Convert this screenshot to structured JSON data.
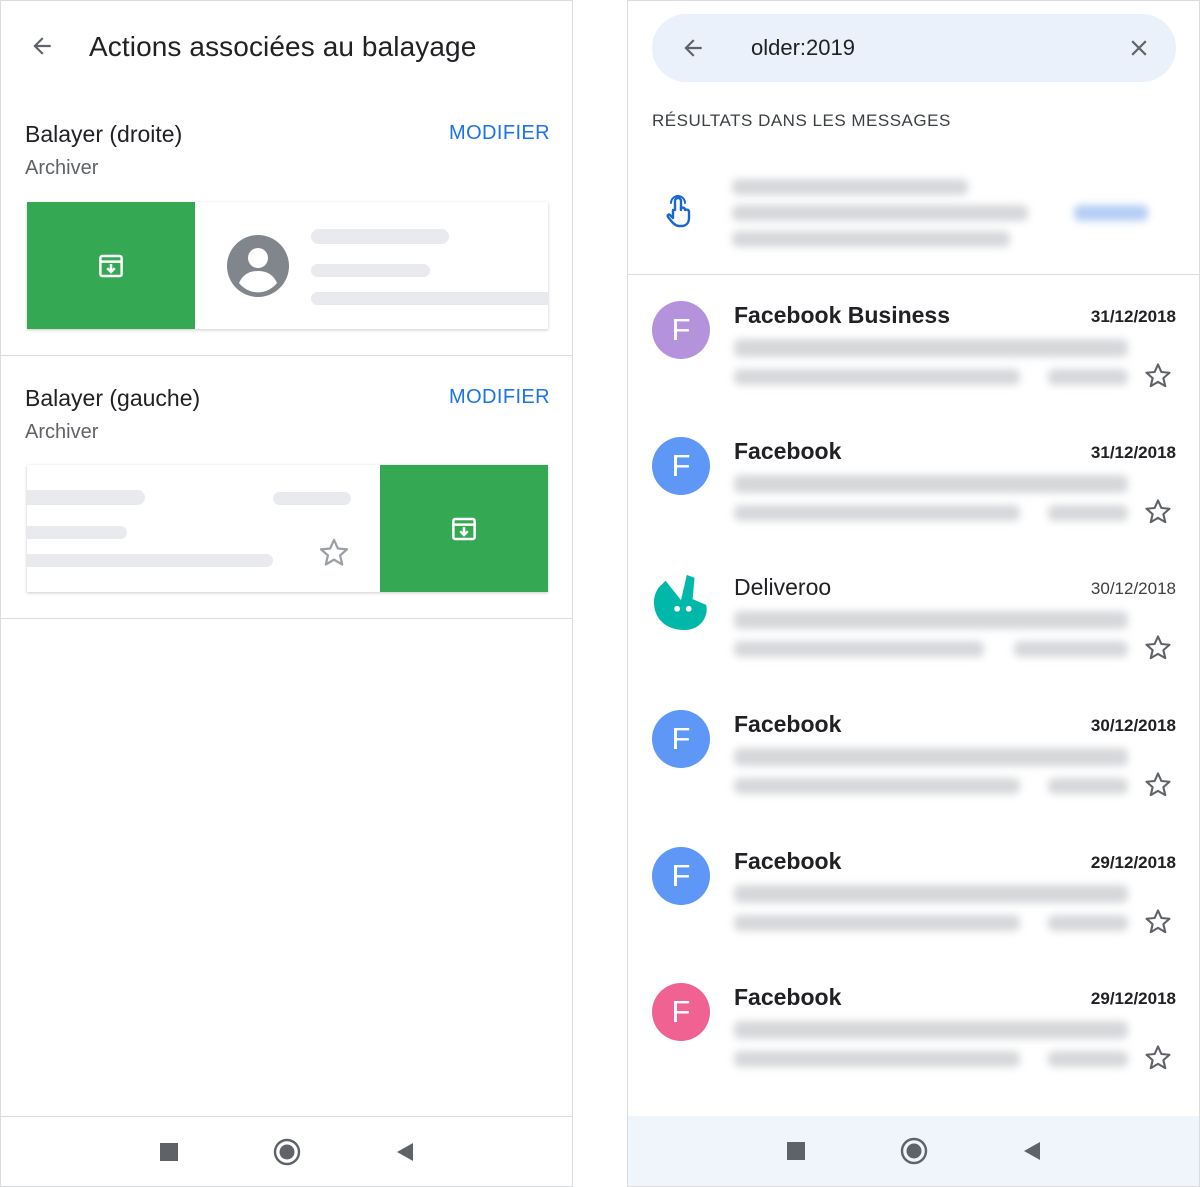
{
  "left_screen": {
    "header": {
      "title": "Actions associées au balayage",
      "back_icon": "arrow-back-icon"
    },
    "swipe_right": {
      "title": "Balayer (droite)",
      "action": "Archiver",
      "modify_label": "MODIFIER"
    },
    "swipe_left": {
      "title": "Balayer (gauche)",
      "action": "Archiver",
      "modify_label": "MODIFIER"
    }
  },
  "right_screen": {
    "search": {
      "query": "older:2019",
      "back_icon": "arrow-back-icon",
      "clear_icon": "close-icon"
    },
    "results_label": "RÉSULTATS DANS LES MESSAGES",
    "messages": [
      {
        "sender": "Facebook Business",
        "date": "31/12/2018",
        "avatar_letter": "F",
        "avatar_color": "#b493dc",
        "unread": true
      },
      {
        "sender": "Facebook",
        "date": "31/12/2018",
        "avatar_letter": "F",
        "avatar_color": "#5e97f6",
        "unread": true
      },
      {
        "sender": "Deliveroo",
        "date": "30/12/2018",
        "avatar_letter": "",
        "avatar_color": "#00b8a9",
        "unread": false
      },
      {
        "sender": "Facebook",
        "date": "30/12/2018",
        "avatar_letter": "F",
        "avatar_color": "#5e97f6",
        "unread": true
      },
      {
        "sender": "Facebook",
        "date": "29/12/2018",
        "avatar_letter": "F",
        "avatar_color": "#5e97f6",
        "unread": true
      },
      {
        "sender": "Facebook",
        "date": "29/12/2018",
        "avatar_letter": "F",
        "avatar_color": "#f06292",
        "unread": true
      }
    ]
  },
  "colors": {
    "archive_green": "#34a853",
    "link_blue": "#1a73e8",
    "search_bg": "#eaf1fb"
  },
  "system_nav": {
    "icons": [
      "stop-square-icon",
      "home-circle-icon",
      "back-triangle-icon"
    ]
  }
}
